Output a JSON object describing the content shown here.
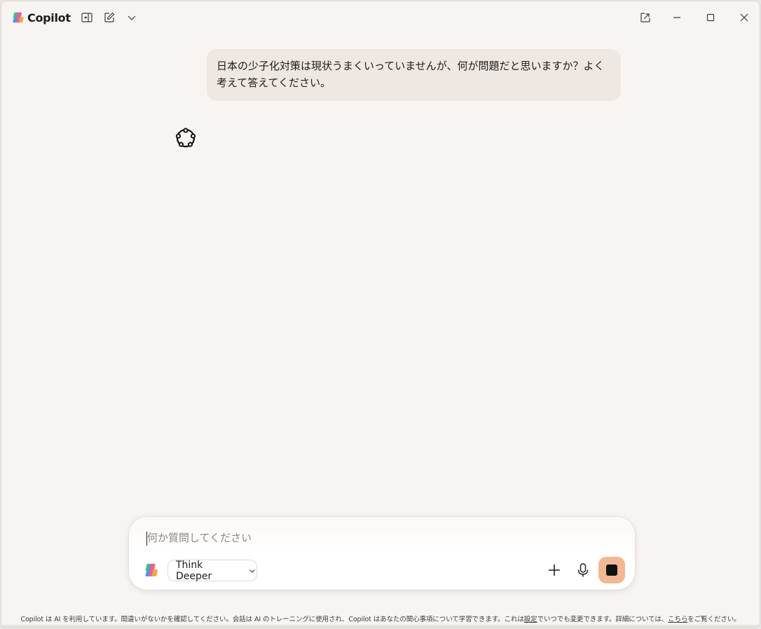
{
  "app": {
    "title": "Copilot",
    "brand_colors": [
      "#f6a14a",
      "#e8558a",
      "#7a5cf0",
      "#2aa7e8",
      "#41c384"
    ]
  },
  "titlebar": {
    "buttons": [
      {
        "name": "sidebar-toggle",
        "icon": "sidebar-icon"
      },
      {
        "name": "new-chat",
        "icon": "compose-icon"
      },
      {
        "name": "more-menu",
        "icon": "chevron-down-icon"
      }
    ],
    "window_buttons": [
      {
        "name": "popout",
        "icon": "popout-icon"
      },
      {
        "name": "minimize",
        "icon": "minimize-icon"
      },
      {
        "name": "maximize",
        "icon": "maximize-icon"
      },
      {
        "name": "close",
        "icon": "close-icon"
      }
    ]
  },
  "conversation": {
    "user_message": "日本の少子化対策は現状うまくいっていませんが、何が問題だと思いますか？よく考えて答えてください。",
    "assistant_state_icon": "thinking-icon"
  },
  "composer": {
    "placeholder": "何か質問してください",
    "mode_label": "Think Deeper",
    "stop_color": "#f2b894"
  },
  "footer": {
    "disclaimer_prefix": "Copilot は AI を利用しています。間違いがないかを確認してください。会話は AI のトレーニングに使用され、Copilot はあなたの関心事項について学習できます。これは",
    "settings_link": "設定",
    "disclaimer_middle": "でいつでも変更できます。詳細については、",
    "here_link": "こちら",
    "disclaimer_suffix": "をご覧ください。"
  }
}
